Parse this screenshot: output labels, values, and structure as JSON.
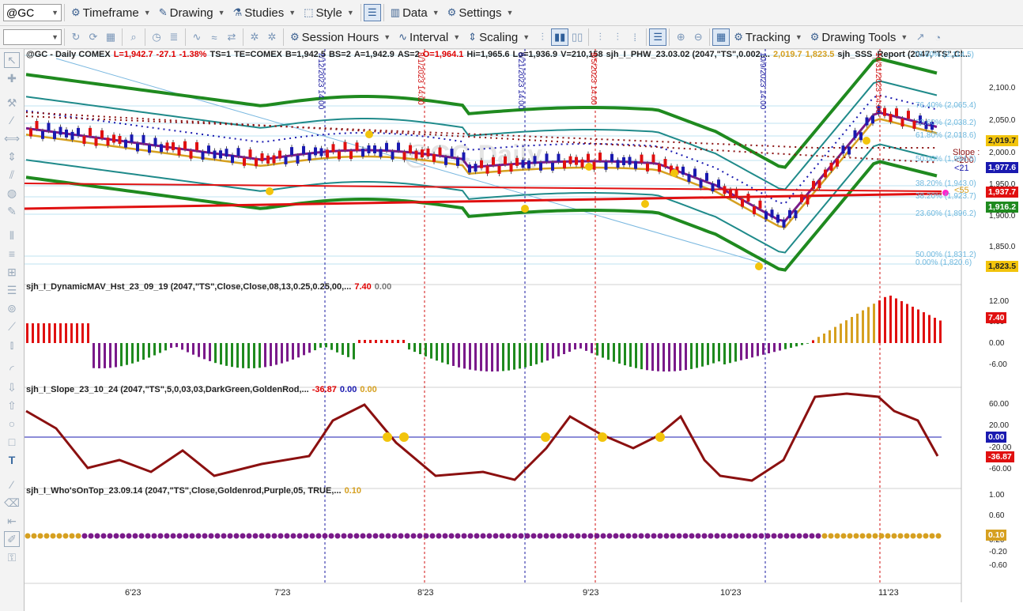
{
  "toolbar": {
    "symbol": "@GC",
    "items": [
      {
        "label": "Timeframe",
        "icon": "timeframe-icon"
      },
      {
        "label": "Drawing",
        "icon": "drawing-icon"
      },
      {
        "label": "Studies",
        "icon": "studies-icon"
      },
      {
        "label": "Style",
        "icon": "style-icon"
      },
      {
        "label": "Data",
        "icon": "data-icon"
      },
      {
        "label": "Settings",
        "icon": "settings-icon"
      }
    ],
    "row2": {
      "session_hours": "Session Hours",
      "interval": "Interval",
      "scaling": "Scaling",
      "tracking": "Tracking",
      "drawing_tools": "Drawing Tools"
    }
  },
  "price_panel": {
    "header": [
      {
        "text": "@GC - Daily  COMEX",
        "color": "dark"
      },
      {
        "text": "L=1,942.7",
        "color": "red"
      },
      {
        "text": "-27.1",
        "color": "red"
      },
      {
        "text": "-1.38%",
        "color": "red"
      },
      {
        "text": "TS=1",
        "color": "dark"
      },
      {
        "text": "TE=COMEX",
        "color": "dark"
      },
      {
        "text": "B=1,942.5",
        "color": "dark"
      },
      {
        "text": "BS=2",
        "color": "dark"
      },
      {
        "text": "A=1,942.9",
        "color": "dark"
      },
      {
        "text": "AS=2",
        "color": "dark"
      },
      {
        "text": "O=1,964.1",
        "color": "red"
      },
      {
        "text": "Hi=1,965.6",
        "color": "dark"
      },
      {
        "text": "Lo=1,936.9",
        "color": "dark"
      },
      {
        "text": "V=210,158",
        "color": "dark"
      },
      {
        "text": "sjh_I_PHW_23.03.02 (2047,\"TS\",0.002,...",
        "color": "dark"
      },
      {
        "text": "2,019.7",
        "color": "gold"
      },
      {
        "text": "1,823.5",
        "color": "gold"
      },
      {
        "text": "sjh_SSS_Report (2047,\"TS\",Cl...",
        "color": "dark"
      }
    ],
    "y_labels": [
      "2,100.0",
      "2,050.0",
      "2,000.0",
      "1,950.0",
      "1,900.0",
      "1,850.0"
    ],
    "tags": [
      {
        "text": "2,019.7",
        "bg": "#f2c40c",
        "fg": "#222222"
      },
      {
        "text": "1,977.6",
        "bg": "#1a1ab0",
        "fg": "#ffffff"
      },
      {
        "text": "1,937.7",
        "bg": "#e01010",
        "fg": "#ffffff"
      },
      {
        "text": "1,916.2",
        "bg": "#1f8a1f",
        "fg": "#ffffff"
      },
      {
        "text": "1,823.5",
        "bg": "#f2c40c",
        "fg": "#222222"
      }
    ],
    "side_notes": {
      "slope": "Slope :",
      "lt200": "<200",
      "lt21": "<21",
      "lt55": "<55"
    },
    "fib_labels": [
      "78.60% (2,114.5)",
      "76.40% (2,065.4)",
      "23.60% (2,038.2)",
      "61.80% (2,018.6)",
      "50.00% (1,994.5)",
      "38.20% (1,943.0)",
      "38.20% (1,923.7)",
      "23.60% (1,896.2)",
      "50.00% (1,831.2)",
      "0.00% (1,820.6)"
    ],
    "watermark": "@GC Daily",
    "vlines": [
      {
        "label": "7/12/2023 14:00",
        "color": "#1a1aa0"
      },
      {
        "label": "8/1/2023 14:00",
        "color": "#d01010"
      },
      {
        "label": "8/21/2023 14:00",
        "color": "#1a1aa0"
      },
      {
        "label": "9/5/2023 14:00",
        "color": "#d01010"
      },
      {
        "label": "10/9/2023 14:00",
        "color": "#1a1aa0"
      },
      {
        "label": "10/31/2023 14:00",
        "color": "#d01010"
      }
    ]
  },
  "panel2": {
    "title": "sjh_I_DynamicMAV_Hst_23_09_19 (2047,\"TS\",Close,Close,08,13,0.25,0.25,00,...",
    "v1": "7.40",
    "v2": "0.00",
    "y_labels": [
      "12.00",
      "6.00",
      "0.00",
      "-6.00"
    ],
    "tag": "7.40"
  },
  "panel3": {
    "title": "sjh_I_Slope_23_10_24 (2047,\"TS\",5,0,03,03,DarkGreen,GoldenRod,...",
    "v1": "-36.87",
    "v2": "0.00",
    "v3": "0.00",
    "y_labels": [
      "60.00",
      "20.00",
      "-20.00",
      "-60.00"
    ],
    "tag_zero": "0.00",
    "tag": "-36.87"
  },
  "panel4": {
    "title": "sjh_I_Who'sOnTop_23.09.14 (2047,\"TS\",Close,Goldenrod,Purple,05,  TRUE,...",
    "v1": "0.10",
    "y_labels": [
      "1.00",
      "0.60",
      "0.20",
      "-0.20",
      "-0.60"
    ],
    "tag": "0.10"
  },
  "x_labels": [
    "6'23",
    "7'23",
    "8'23",
    "9'23",
    "10'23",
    "11'23"
  ],
  "colors": {
    "up": "#1a1ab0",
    "down": "#e01010",
    "band": "#1f8a1f",
    "teal": "#1f8a8a",
    "purple": "#7a1a8a",
    "gold": "#d6a020",
    "maroon": "#8b1010"
  }
}
